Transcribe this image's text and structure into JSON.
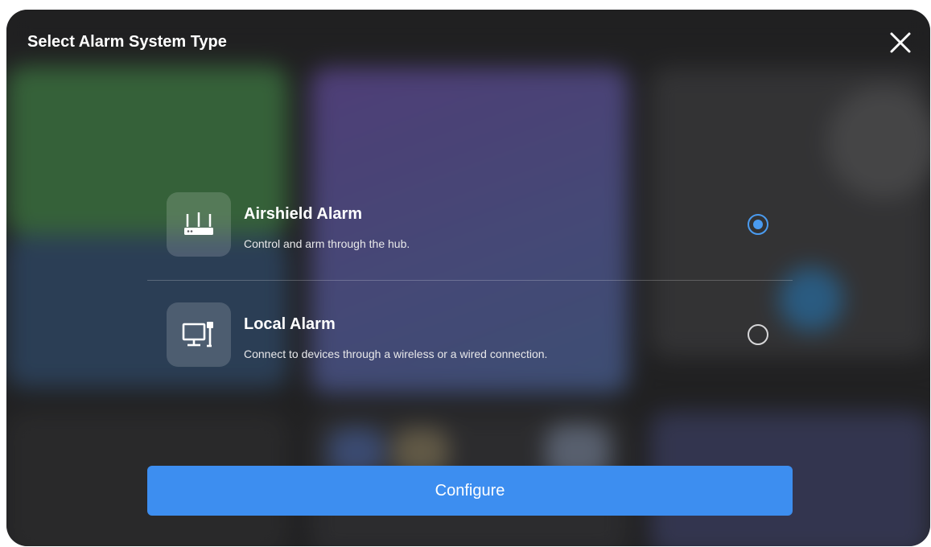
{
  "dialog": {
    "title": "Select Alarm System Type",
    "close_icon": "close-icon"
  },
  "options": [
    {
      "title": "Airshield Alarm",
      "description": "Control and arm through the hub.",
      "icon": "router-icon",
      "selected": true
    },
    {
      "title": "Local Alarm",
      "description": "Connect to devices through a wireless or a wired connection.",
      "icon": "monitor-connection-icon",
      "selected": false
    }
  ],
  "actions": {
    "configure_label": "Configure"
  },
  "colors": {
    "accent": "#3d8ef0",
    "radio_selected": "#4a9bf0"
  }
}
